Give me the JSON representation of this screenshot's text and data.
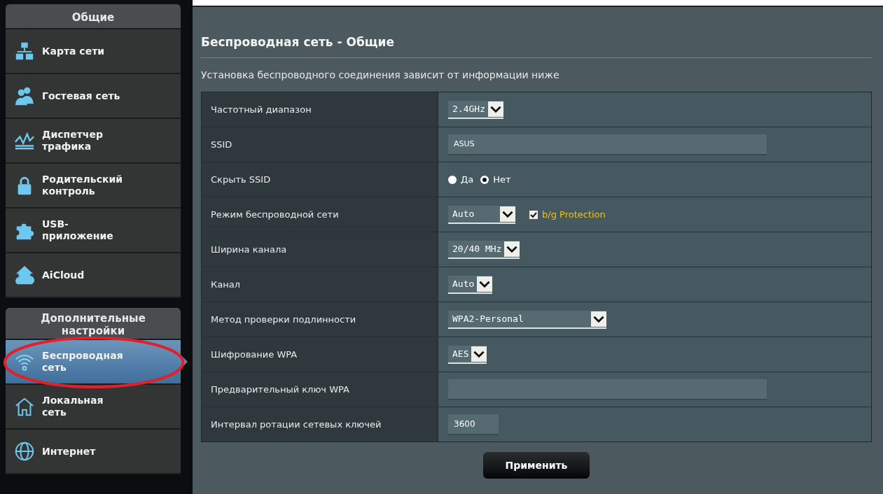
{
  "sidebar": {
    "sections": [
      {
        "title": "Общие",
        "items": [
          {
            "label": "Карта сети",
            "selected": false
          },
          {
            "label": "Гостевая сеть",
            "selected": false
          },
          {
            "label": "Диспетчер трафика",
            "selected": false
          },
          {
            "label": "Родительский контроль",
            "selected": false
          },
          {
            "label": "USB-приложение",
            "selected": false
          },
          {
            "label": "AiCloud",
            "selected": false
          }
        ]
      },
      {
        "title": "Дополнительные настройки",
        "items": [
          {
            "label": "Беспроводная сеть",
            "selected": true
          },
          {
            "label": "Локальная сеть",
            "selected": false
          },
          {
            "label": "Интернет",
            "selected": false
          }
        ]
      }
    ]
  },
  "page": {
    "title": "Беспроводная сеть - Общие",
    "description": "Установка беспроводного соединения зависит от информации ниже",
    "rows": [
      {
        "label": "Частотный диапазон",
        "kind": "select",
        "value": "2.4GHz"
      },
      {
        "label": "SSID",
        "kind": "text",
        "value": "ASUS"
      },
      {
        "label": "Скрыть SSID",
        "kind": "radio",
        "options": [
          {
            "label": "Да",
            "selected": false
          },
          {
            "label": "Нет",
            "selected": true
          }
        ]
      },
      {
        "label": "Режим беспроводной сети",
        "kind": "select",
        "value": "Auto",
        "checkbox": {
          "label": "b/g Protection",
          "checked": true
        }
      },
      {
        "label": "Ширина канала",
        "kind": "select",
        "value": "20/40 MHz"
      },
      {
        "label": "Канал",
        "kind": "select",
        "value": "Auto"
      },
      {
        "label": "Метод проверки подлинности",
        "kind": "select",
        "value": "WPA2-Personal"
      },
      {
        "label": "Шифрование WPA",
        "kind": "select",
        "value": "AES"
      },
      {
        "label": "Предварительный ключ WPA",
        "kind": "password"
      },
      {
        "label": "Интервал ротации сетевых ключей",
        "kind": "number",
        "value": "3600"
      }
    ],
    "apply_button": "Применить"
  }
}
